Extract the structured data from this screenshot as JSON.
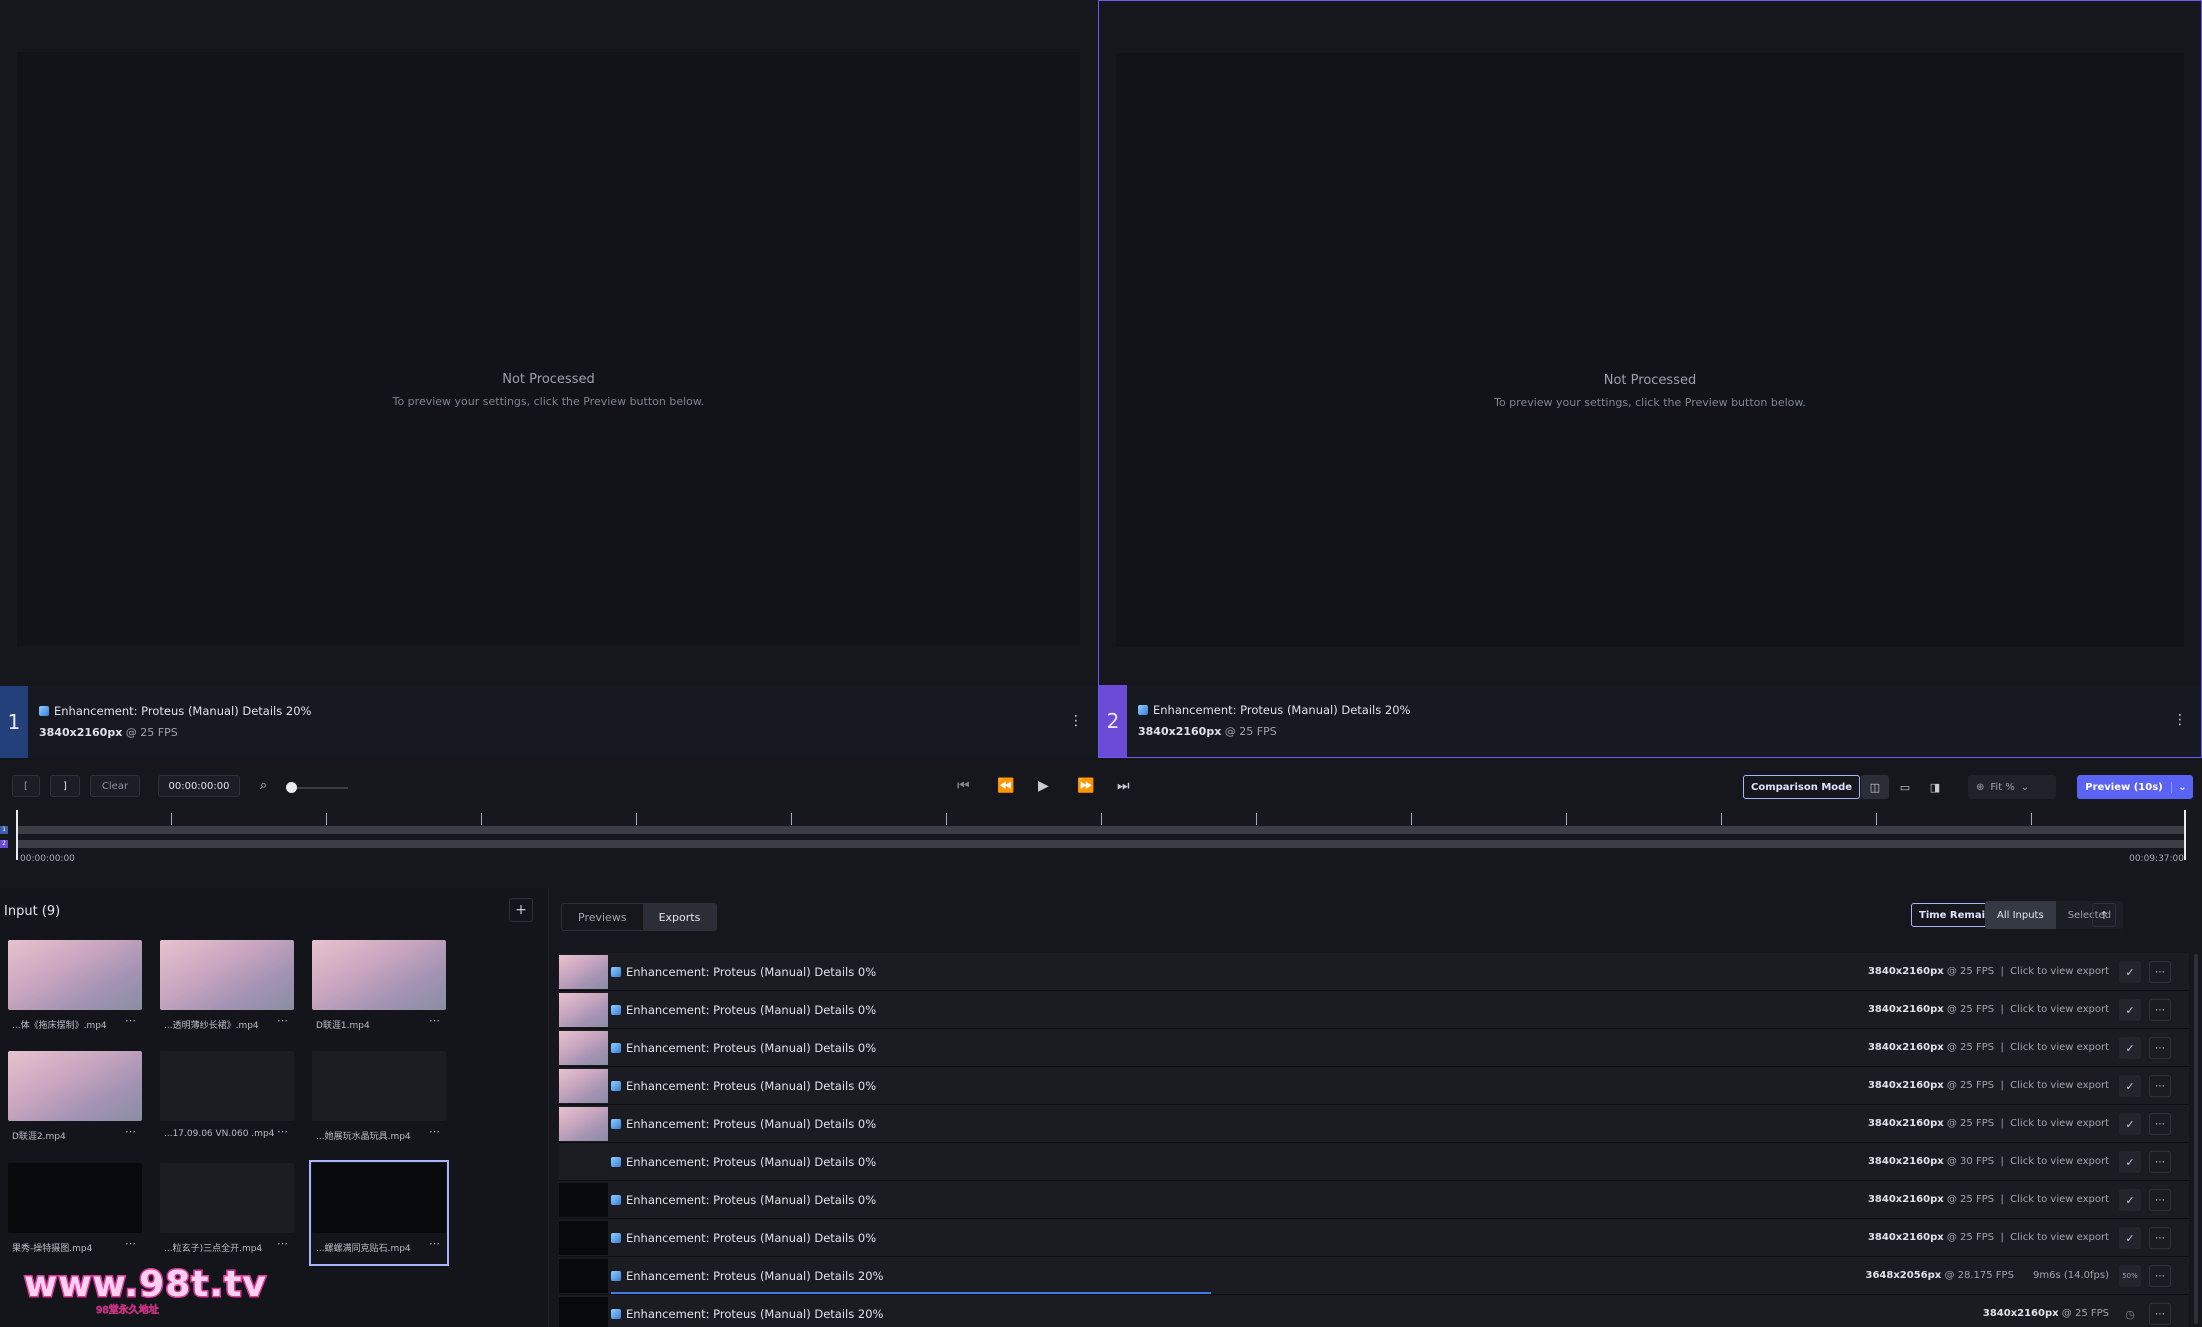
{
  "panes": [
    {
      "number": "1",
      "status_title": "Not Processed",
      "status_sub": "To preview your settings, click the Preview button below.",
      "label": "Enhancement: Proteus (Manual) Details 20%",
      "resolution": "3840x2160px",
      "fps": "@ 25 FPS"
    },
    {
      "number": "2",
      "status_title": "Not Processed",
      "status_sub": "To preview your settings, click the Preview button below.",
      "label": "Enhancement: Proteus (Manual) Details 20%",
      "resolution": "3840x2160px",
      "fps": "@ 25 FPS"
    }
  ],
  "transport": {
    "in_mark": "[",
    "out_mark": "]",
    "clear_label": "Clear",
    "timecode": "00:00:00:00",
    "comparison_label": "Comparison Mode",
    "zoom_label": "Fit %",
    "preview_label": "Preview (10s)"
  },
  "timeline": {
    "start_time": "00:00:00:00",
    "end_time": "00:09:37:00",
    "track_labels": [
      "1",
      "2"
    ]
  },
  "input": {
    "title": "Input (9)",
    "add_label": "+",
    "files": [
      {
        "name": "...体《拖床摆制》.mp4",
        "style": "pink"
      },
      {
        "name": "...透明薄纱长裙》.mp4",
        "style": "pink"
      },
      {
        "name": "D联涯1.mp4",
        "style": "pink"
      },
      {
        "name": "D联涯2.mp4",
        "style": "pink"
      },
      {
        "name": "...17.09.06 VN.060 .mp4",
        "style": "dark"
      },
      {
        "name": "...她展玩水晶玩具.mp4",
        "style": "dark"
      },
      {
        "name": "果秀-操特摄图.mp4",
        "style": "black"
      },
      {
        "name": "...粒玄子)三点全开.mp4",
        "style": "dark"
      },
      {
        "name": "...螺螺满同克贴石.mp4",
        "style": "black"
      }
    ]
  },
  "exports": {
    "tabs": [
      "Previews",
      "Exports"
    ],
    "active_tab": "Exports",
    "time_remaining_label": "Time Remaining",
    "filters": [
      "All Inputs",
      "Selected"
    ],
    "active_filter": "All Inputs",
    "rows": [
      {
        "label": "Enhancement: Proteus (Manual) Details 0%",
        "res": "3840x2160px",
        "meta": "@ 25 FPS  |  Click to view export",
        "state": "done",
        "thumb": "pink"
      },
      {
        "label": "Enhancement: Proteus (Manual) Details 0%",
        "res": "3840x2160px",
        "meta": "@ 25 FPS  |  Click to view export",
        "state": "done",
        "thumb": "pink"
      },
      {
        "label": "Enhancement: Proteus (Manual) Details 0%",
        "res": "3840x2160px",
        "meta": "@ 25 FPS  |  Click to view export",
        "state": "done",
        "thumb": "pink"
      },
      {
        "label": "Enhancement: Proteus (Manual) Details 0%",
        "res": "3840x2160px",
        "meta": "@ 25 FPS  |  Click to view export",
        "state": "done",
        "thumb": "pink"
      },
      {
        "label": "Enhancement: Proteus (Manual) Details 0%",
        "res": "3840x2160px",
        "meta": "@ 25 FPS  |  Click to view export",
        "state": "done",
        "thumb": "pink"
      },
      {
        "label": "Enhancement: Proteus (Manual) Details 0%",
        "res": "3840x2160px",
        "meta": "@ 30 FPS  |  Click to view export",
        "state": "done",
        "thumb": "dark"
      },
      {
        "label": "Enhancement: Proteus (Manual) Details 0%",
        "res": "3840x2160px",
        "meta": "@ 25 FPS  |  Click to view export",
        "state": "done",
        "thumb": "black"
      },
      {
        "label": "Enhancement: Proteus (Manual) Details 0%",
        "res": "3840x2160px",
        "meta": "@ 25 FPS  |  Click to view export",
        "state": "done",
        "thumb": "black"
      },
      {
        "label": "Enhancement: Proteus (Manual) Details 20%",
        "res": "3648x2056px",
        "meta": "@ 28.175 FPS      9m6s (14.0fps)",
        "state": "progress",
        "percent": "50%",
        "progress": 0.5,
        "thumb": "black"
      },
      {
        "label": "Enhancement: Proteus (Manual) Details 20%",
        "res": "3840x2160px",
        "meta": "@ 25 FPS",
        "state": "queued",
        "thumb": "black"
      }
    ]
  },
  "watermark": {
    "text": "www.98t.tv",
    "sub": "98堂永久地址"
  },
  "colors": {
    "accent": "#5b63f5",
    "pane1": "#24407a",
    "pane2": "#6b4ad6",
    "progress": "#3c7de8"
  }
}
